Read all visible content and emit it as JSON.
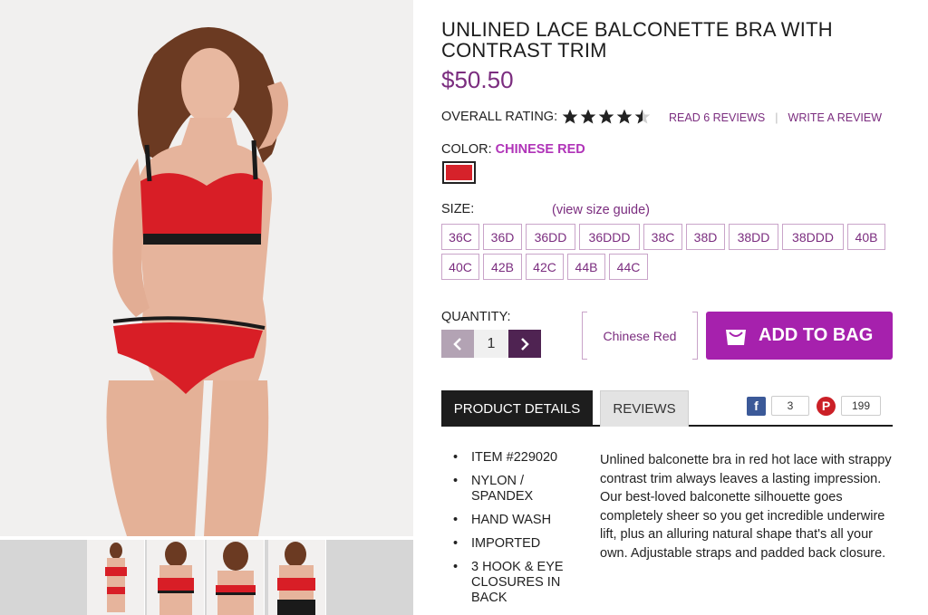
{
  "product": {
    "title": "UNLINED LACE BALCONETTE BRA WITH CONTRAST TRIM",
    "price": "$50.50",
    "rating_label": "OVERALL RATING:",
    "rating_value": 4.5,
    "read_reviews": "READ 6 REVIEWS",
    "write_review": "WRITE A REVIEW",
    "color_label": "COLOR:",
    "color_value": "CHINESE RED",
    "swatch_color": "#d6222a",
    "size_label": "SIZE:",
    "size_guide": "(view size guide)",
    "sizes": [
      "36C",
      "36D",
      "36DD",
      "36DDD",
      "38C",
      "38D",
      "38DD",
      "38DDD",
      "40B",
      "40C",
      "42B",
      "42C",
      "44B",
      "44C"
    ],
    "quantity_label": "QUANTITY:",
    "quantity_value": "1",
    "selected_color": "Chinese Red",
    "add_to_bag": "ADD TO BAG"
  },
  "tabs": {
    "details": "PRODUCT DETAILS",
    "reviews": "REVIEWS"
  },
  "social": {
    "facebook_count": "3",
    "pinterest_count": "199"
  },
  "details": {
    "bullets": [
      "ITEM #229020",
      "NYLON / SPANDEX",
      "HAND WASH",
      "IMPORTED",
      "3 HOOK & EYE CLOSURES IN BACK"
    ],
    "description": "Unlined balconette bra in red hot lace with strappy contrast trim always leaves a lasting impression. Our best-loved balconette silhouette goes completely sheer so you get incredible underwire lift, plus an alluring natural shape that's all your own. Adjustable straps and padded back closure."
  },
  "colors": {
    "accent": "#a621ad",
    "brand_purple": "#7b2d7f",
    "dark": "#1d1d1d"
  }
}
